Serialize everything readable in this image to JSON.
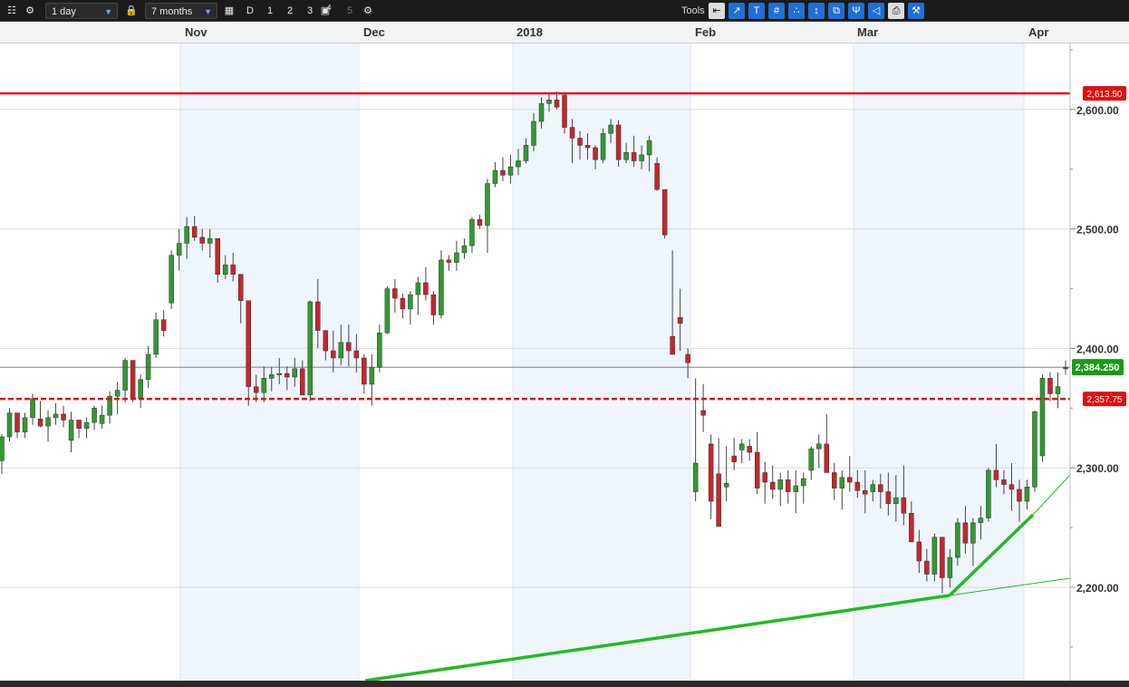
{
  "toolbar": {
    "interval": "1 day",
    "range": "7 months",
    "period_buttons": [
      "D",
      "1",
      "2",
      "3"
    ],
    "superscript": "4",
    "extra": "5",
    "tools_label": "Tools"
  },
  "chart_data": {
    "type": "candlestick",
    "instrument_timeframe": "1 day",
    "y_ticks": [
      2200,
      2300,
      2400,
      2500,
      2600
    ],
    "y_tick_labels": [
      "2,200.00",
      "2,300.00",
      "2,400.00",
      "2,500.00",
      "2,600.00"
    ],
    "ylim": [
      2120,
      2660
    ],
    "x_month_labels": [
      "Nov",
      "Dec",
      "2018",
      "Feb",
      "Mar",
      "Apr"
    ],
    "horizontal_lines": [
      {
        "value": 2613.5,
        "label": "2,613.50",
        "style": "solid",
        "color": "#e01010"
      },
      {
        "value": 2357.75,
        "label": "2,357.75",
        "style": "dashed",
        "color": "#e01010"
      }
    ],
    "last_price": {
      "value": 2384.25,
      "label": "2,384.250",
      "color": "#1a9a1a"
    },
    "trendlines_color": "#22bb22",
    "candles": [
      [
        2306,
        2328,
        2295,
        2326
      ],
      [
        2326,
        2350,
        2322,
        2346
      ],
      [
        2346,
        2338,
        2325,
        2330
      ],
      [
        2330,
        2346,
        2325,
        2342
      ],
      [
        2342,
        2362,
        2336,
        2358
      ],
      [
        2341,
        2356,
        2334,
        2335
      ],
      [
        2335,
        2348,
        2322,
        2342
      ],
      [
        2342,
        2354,
        2336,
        2345
      ],
      [
        2345,
        2352,
        2334,
        2340
      ],
      [
        2323,
        2347,
        2313,
        2340
      ],
      [
        2340,
        2338,
        2325,
        2333
      ],
      [
        2333,
        2342,
        2325,
        2338
      ],
      [
        2338,
        2352,
        2332,
        2350
      ],
      [
        2337,
        2352,
        2333,
        2344
      ],
      [
        2344,
        2364,
        2337,
        2360
      ],
      [
        2360,
        2372,
        2345,
        2365
      ],
      [
        2365,
        2392,
        2355,
        2390
      ],
      [
        2390,
        2387,
        2355,
        2358
      ],
      [
        2358,
        2378,
        2350,
        2374
      ],
      [
        2374,
        2402,
        2367,
        2395
      ],
      [
        2395,
        2430,
        2392,
        2424
      ],
      [
        2424,
        2432,
        2410,
        2415
      ],
      [
        2438,
        2482,
        2433,
        2478
      ],
      [
        2478,
        2500,
        2465,
        2488
      ],
      [
        2488,
        2510,
        2475,
        2502
      ],
      [
        2502,
        2511,
        2490,
        2493
      ],
      [
        2493,
        2500,
        2482,
        2488
      ],
      [
        2488,
        2500,
        2476,
        2492
      ],
      [
        2492,
        2490,
        2455,
        2462
      ],
      [
        2462,
        2478,
        2458,
        2470
      ],
      [
        2470,
        2480,
        2456,
        2462
      ],
      [
        2462,
        2452,
        2421,
        2440
      ],
      [
        2440,
        2412,
        2352,
        2368
      ],
      [
        2368,
        2378,
        2355,
        2363
      ],
      [
        2363,
        2385,
        2355,
        2375
      ],
      [
        2375,
        2384,
        2364,
        2378
      ],
      [
        2378,
        2392,
        2370,
        2379
      ],
      [
        2379,
        2385,
        2365,
        2376
      ],
      [
        2376,
        2392,
        2368,
        2383
      ],
      [
        2383,
        2390,
        2362,
        2361
      ],
      [
        2361,
        2440,
        2356,
        2439
      ],
      [
        2439,
        2458,
        2400,
        2415
      ],
      [
        2415,
        2410,
        2390,
        2398
      ],
      [
        2398,
        2415,
        2380,
        2392
      ],
      [
        2392,
        2420,
        2386,
        2405
      ],
      [
        2405,
        2420,
        2385,
        2398
      ],
      [
        2398,
        2412,
        2380,
        2392
      ],
      [
        2392,
        2395,
        2362,
        2370
      ],
      [
        2370,
        2395,
        2352,
        2384
      ],
      [
        2384,
        2420,
        2380,
        2413
      ],
      [
        2413,
        2452,
        2412,
        2450
      ],
      [
        2450,
        2458,
        2430,
        2442
      ],
      [
        2442,
        2446,
        2425,
        2433
      ],
      [
        2433,
        2448,
        2420,
        2445
      ],
      [
        2445,
        2460,
        2428,
        2455
      ],
      [
        2455,
        2468,
        2440,
        2445
      ],
      [
        2445,
        2448,
        2420,
        2428
      ],
      [
        2428,
        2482,
        2425,
        2474
      ],
      [
        2474,
        2478,
        2465,
        2472
      ],
      [
        2472,
        2490,
        2465,
        2480
      ],
      [
        2480,
        2492,
        2475,
        2486
      ],
      [
        2486,
        2510,
        2480,
        2508
      ],
      [
        2508,
        2512,
        2500,
        2503
      ],
      [
        2503,
        2542,
        2480,
        2538
      ],
      [
        2538,
        2556,
        2535,
        2549
      ],
      [
        2549,
        2560,
        2540,
        2545
      ],
      [
        2545,
        2562,
        2538,
        2552
      ],
      [
        2552,
        2567,
        2545,
        2557
      ],
      [
        2557,
        2576,
        2555,
        2570
      ],
      [
        2570,
        2597,
        2565,
        2590
      ],
      [
        2590,
        2610,
        2584,
        2605
      ],
      [
        2605,
        2614,
        2598,
        2608
      ],
      [
        2608,
        2615,
        2600,
        2602
      ],
      [
        2612,
        2614,
        2580,
        2585
      ],
      [
        2585,
        2592,
        2555,
        2576
      ],
      [
        2576,
        2582,
        2558,
        2570
      ],
      [
        2570,
        2580,
        2558,
        2568
      ],
      [
        2568,
        2570,
        2550,
        2558
      ],
      [
        2558,
        2584,
        2555,
        2580
      ],
      [
        2580,
        2592,
        2572,
        2587
      ],
      [
        2587,
        2591,
        2552,
        2558
      ],
      [
        2558,
        2572,
        2555,
        2564
      ],
      [
        2564,
        2578,
        2552,
        2557
      ],
      [
        2557,
        2570,
        2550,
        2562
      ],
      [
        2562,
        2578,
        2548,
        2574
      ],
      [
        2555,
        2560,
        2532,
        2533
      ],
      [
        2533,
        2530,
        2492,
        2495
      ],
      [
        2410,
        2482,
        2400,
        2395
      ],
      [
        2426,
        2450,
        2398,
        2421
      ],
      [
        2395,
        2400,
        2375,
        2388
      ],
      [
        2280,
        2375,
        2272,
        2304
      ],
      [
        2348,
        2370,
        2330,
        2344
      ],
      [
        2320,
        2328,
        2257,
        2272
      ],
      [
        2295,
        2325,
        2252,
        2251
      ],
      [
        2284,
        2318,
        2272,
        2287
      ],
      [
        2310,
        2325,
        2298,
        2305
      ],
      [
        2315,
        2324,
        2304,
        2320
      ],
      [
        2318,
        2324,
        2306,
        2313
      ],
      [
        2313,
        2330,
        2278,
        2283
      ],
      [
        2296,
        2305,
        2270,
        2288
      ],
      [
        2288,
        2302,
        2274,
        2282
      ],
      [
        2282,
        2296,
        2268,
        2290
      ],
      [
        2290,
        2298,
        2270,
        2280
      ],
      [
        2280,
        2298,
        2262,
        2285
      ],
      [
        2285,
        2296,
        2270,
        2291
      ],
      [
        2298,
        2318,
        2290,
        2316
      ],
      [
        2316,
        2328,
        2300,
        2320
      ],
      [
        2320,
        2345,
        2298,
        2296
      ],
      [
        2296,
        2304,
        2273,
        2283
      ],
      [
        2283,
        2298,
        2265,
        2292
      ],
      [
        2292,
        2310,
        2280,
        2288
      ],
      [
        2288,
        2298,
        2275,
        2281
      ],
      [
        2281,
        2298,
        2262,
        2278
      ],
      [
        2280,
        2290,
        2272,
        2286
      ],
      [
        2286,
        2295,
        2266,
        2280
      ],
      [
        2280,
        2296,
        2260,
        2270
      ],
      [
        2270,
        2294,
        2255,
        2275
      ],
      [
        2275,
        2302,
        2252,
        2262
      ],
      [
        2262,
        2272,
        2240,
        2238
      ],
      [
        2238,
        2248,
        2212,
        2222
      ],
      [
        2222,
        2232,
        2205,
        2211
      ],
      [
        2211,
        2245,
        2205,
        2242
      ],
      [
        2242,
        2232,
        2195,
        2208
      ],
      [
        2208,
        2232,
        2200,
        2225
      ],
      [
        2225,
        2258,
        2218,
        2254
      ],
      [
        2254,
        2268,
        2228,
        2237
      ],
      [
        2237,
        2258,
        2218,
        2254
      ],
      [
        2254,
        2268,
        2240,
        2258
      ],
      [
        2258,
        2300,
        2255,
        2298
      ],
      [
        2298,
        2320,
        2284,
        2290
      ],
      [
        2290,
        2298,
        2278,
        2286
      ],
      [
        2286,
        2304,
        2264,
        2282
      ],
      [
        2282,
        2290,
        2255,
        2272
      ],
      [
        2272,
        2290,
        2265,
        2284
      ],
      [
        2284,
        2348,
        2280,
        2347
      ],
      [
        2310,
        2378,
        2305,
        2375
      ],
      [
        2375,
        2380,
        2356,
        2362
      ],
      [
        2362,
        2380,
        2350,
        2368
      ],
      [
        2384,
        2390,
        2378,
        2383
      ]
    ]
  }
}
